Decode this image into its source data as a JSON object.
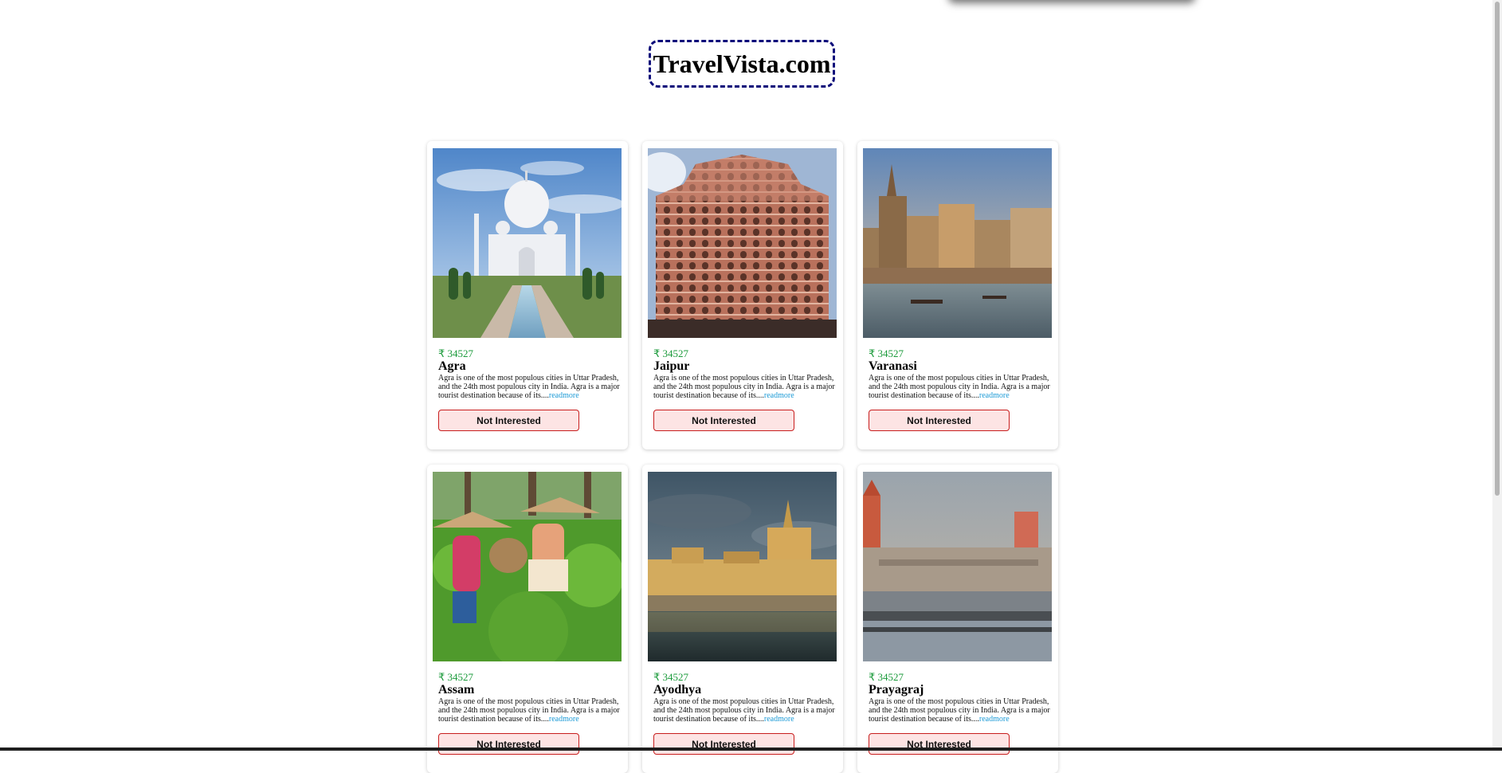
{
  "brand": {
    "title": "TravelVista.com"
  },
  "cards": [
    {
      "price": "₹ 34527",
      "name": "Agra",
      "description": "Agra is one of the most populous cities in Uttar Pradesh, and the 24th most populous city in India. Agra is a major tourist destination because of its....",
      "readmore": "readmore",
      "button": "Not Interested"
    },
    {
      "price": "₹ 34527",
      "name": "Jaipur",
      "description": "Agra is one of the most populous cities in Uttar Pradesh, and the 24th most populous city in India. Agra is a major tourist destination because of its....",
      "readmore": "readmore",
      "button": "Not Interested"
    },
    {
      "price": "₹ 34527",
      "name": "Varanasi",
      "description": "Agra is one of the most populous cities in Uttar Pradesh, and the 24th most populous city in India. Agra is a major tourist destination because of its....",
      "readmore": "readmore",
      "button": "Not Interested"
    },
    {
      "price": "₹ 34527",
      "name": "Assam",
      "description": "Agra is one of the most populous cities in Uttar Pradesh, and the 24th most populous city in India. Agra is a major tourist destination because of its....",
      "readmore": "readmore",
      "button": "Not Interested"
    },
    {
      "price": "₹ 34527",
      "name": "Ayodhya",
      "description": "Agra is one of the most populous cities in Uttar Pradesh, and the 24th most populous city in India. Agra is a major tourist destination because of its....",
      "readmore": "readmore",
      "button": "Not Interested"
    },
    {
      "price": "₹ 34527",
      "name": "Prayagraj",
      "description": "Agra is one of the most populous cities in Uttar Pradesh, and the 24th most populous city in India. Agra is a major tourist destination because of its....",
      "readmore": "readmore",
      "button": "Not Interested"
    }
  ],
  "colors": {
    "price": "#1a9a3a",
    "link": "#1b9ad6",
    "button_border": "#c81e1e",
    "button_bg": "#fde4e4",
    "logo_border": "#0b0b7a"
  }
}
